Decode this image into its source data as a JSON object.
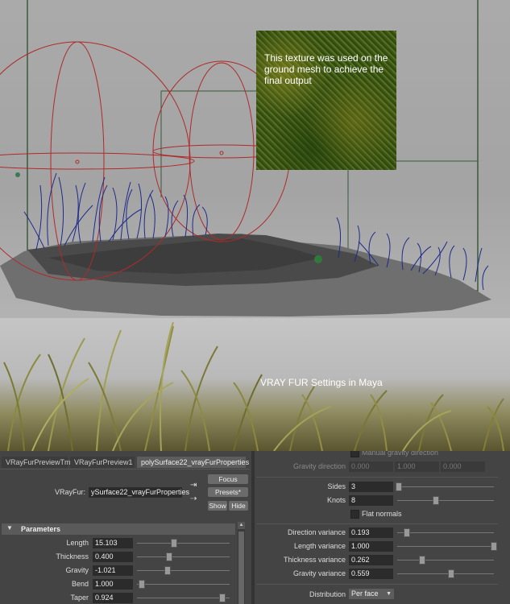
{
  "viewport": {
    "texture_note": "This texture was used on the ground mesh to achieve the final output"
  },
  "render": {
    "caption": "VRAY FUR Settings in Maya"
  },
  "tabs": [
    {
      "label": "VRayFurPreviewTm"
    },
    {
      "label": "VRayFurPreview1"
    },
    {
      "label": "polySurface22_vrayFurProperties",
      "active": true
    }
  ],
  "node": {
    "label": "VRayFur:",
    "value": "ySurface22_vrayFurProperties"
  },
  "buttons": {
    "focus": "Focus",
    "presets": "Presets*",
    "show": "Show",
    "hide": "Hide"
  },
  "parameters": {
    "title": "Parameters",
    "rows": [
      {
        "label": "Length",
        "value": "15.103",
        "level": 0.4
      },
      {
        "label": "Thickness",
        "value": "0.400",
        "level": 0.35
      },
      {
        "label": "Gravity",
        "value": "-1.021",
        "level": 0.33
      },
      {
        "label": "Bend",
        "value": "1.000",
        "level": 0.05
      },
      {
        "label": "Taper",
        "value": "0.924",
        "level": 0.92
      }
    ]
  },
  "gravity": {
    "manual_label": "Manual gravity direction",
    "direction_label": "Gravity direction",
    "direction": [
      "0.000",
      "1.000",
      "0.000"
    ]
  },
  "geometry": {
    "sides_label": "Sides",
    "sides": "3",
    "sides_level": 0.02,
    "knots_label": "Knots",
    "knots": "8",
    "knots_level": 0.4,
    "flat_normals": "Flat normals"
  },
  "variation": [
    {
      "label": "Direction variance",
      "value": "0.193",
      "level": 0.1
    },
    {
      "label": "Length variance",
      "value": "1.000",
      "level": 1.0
    },
    {
      "label": "Thickness variance",
      "value": "0.262",
      "level": 0.26
    },
    {
      "label": "Gravity variance",
      "value": "0.559",
      "level": 0.56
    }
  ],
  "distribution": {
    "label": "Distribution",
    "value": "Per face"
  }
}
